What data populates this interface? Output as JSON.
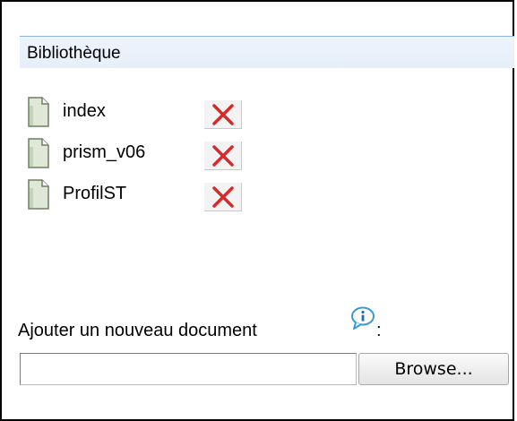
{
  "library": {
    "title": "Bibliothèque",
    "documents": [
      {
        "name": "index",
        "icon": "document-icon",
        "delete_icon": "delete-x-icon"
      },
      {
        "name": "prism_v06",
        "icon": "document-icon",
        "delete_icon": "delete-x-icon"
      },
      {
        "name": "ProfilST",
        "icon": "document-icon",
        "delete_icon": "delete-x-icon"
      }
    ]
  },
  "upload": {
    "label": "Ajouter un nouveau document",
    "info_icon": "info-bubble-icon",
    "colon": ":",
    "file_value": "",
    "browse_label": "Browse..."
  },
  "colors": {
    "header_border": "#8fb4e3",
    "header_bg": "#eef4fc",
    "delete_red": "#d62b2b"
  }
}
